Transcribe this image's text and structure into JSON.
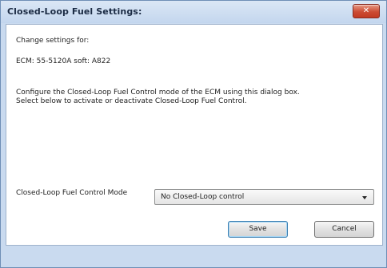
{
  "window": {
    "title": "Closed-Loop Fuel Settings:",
    "close_glyph": "✕"
  },
  "content": {
    "change_settings_for": "Change settings for:",
    "ecm_info": "ECM: 55-5120A soft: A822",
    "description_line1": "Configure the Closed-Loop Fuel Control mode of the ECM using this dialog box.",
    "description_line2": "Select below to activate or deactivate Closed-Loop Fuel Control.",
    "mode_label": "Closed-Loop Fuel Control Mode",
    "mode_selected": "No Closed-Loop control"
  },
  "buttons": {
    "save": "Save",
    "cancel": "Cancel"
  },
  "colors": {
    "title_bar": "#c9daef",
    "close_button": "#cc4b33",
    "default_button_border": "#3c7fb1"
  }
}
